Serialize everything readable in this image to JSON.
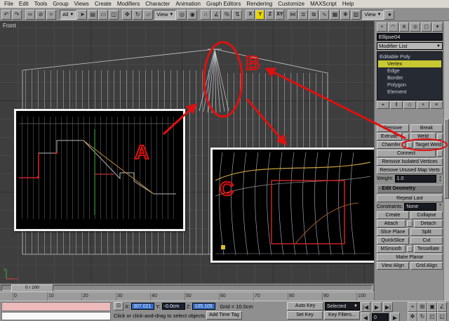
{
  "menu": {
    "items": [
      "File",
      "Edit",
      "Tools",
      "Group",
      "Views",
      "Create",
      "Modifiers",
      "Character",
      "Animation",
      "Graph Editors",
      "Rendering",
      "Customize",
      "MAXScript",
      "Help"
    ]
  },
  "toolbar": {
    "icons": {
      "undo": "↶",
      "redo": "↷",
      "link": "∞",
      "unlink": "⊘",
      "bind": "≈",
      "select": "➤",
      "by_name": "▤",
      "region": "▭",
      "crossing": "◫",
      "move": "✥",
      "rotate": "↻",
      "scale": "▱",
      "pivot": "◎",
      "manip": "◉",
      "snap": "∩",
      "angle": "∡",
      "percent": "%",
      "spinner": "⇅",
      "mirror": "⋈",
      "align": "≣",
      "layer": "⧉",
      "curve": "∿",
      "schem": "▦",
      "material": "❖",
      "render": "▥",
      "teapot": "●"
    },
    "selection_filter": "All",
    "ref_coord": "View",
    "render_type": "View",
    "axis": {
      "x": "X",
      "y": "Y",
      "z": "Z",
      "xy": "XY"
    }
  },
  "viewport": {
    "label": "Front"
  },
  "annotations": {
    "a": "A",
    "b": "B",
    "c": "C"
  },
  "command_panel": {
    "tabs": {
      "create": "+",
      "modify": "◠",
      "hierarchy": "⋔",
      "motion": "◎",
      "display": "▢",
      "utilities": "✦"
    },
    "object_name": "Ellipse04",
    "modifier_list": "Modifier List",
    "stack_root": "Editable Poly",
    "stack_items": [
      {
        "label": "Vertex",
        "selected": true
      },
      {
        "label": "Edge"
      },
      {
        "label": "Border"
      },
      {
        "label": "Polygon"
      },
      {
        "label": "Element"
      }
    ],
    "stack_ops": {
      "pin": "⌖",
      "show_end": "‖",
      "unique": "◇",
      "remove": "×",
      "configure": "≡"
    },
    "edit_vertices": {
      "remove": "Remove",
      "break": "Break",
      "extrude": "Extrude",
      "weld": "Weld",
      "chamfer": "Chamfer",
      "target_weld": "Target Weld",
      "connect": "Connect",
      "remove_isolated": "Remove Isolated Vertices",
      "remove_unused": "Remove Unused Map Verts",
      "weight_label": "Weight:",
      "weight_value": "1.0"
    },
    "edit_geometry": {
      "header": "- Edit Geometry",
      "repeat_last": "Repeat Last",
      "constraints_label": "Constraints:",
      "constraints_value": "None",
      "create": "Create",
      "collapse": "Collapse",
      "attach": "Attach",
      "detach": "Detach",
      "slice_plane": "Slice Plane",
      "split": "Split",
      "quickslice": "QuickSlice",
      "cut": "Cut",
      "msmooth": "MSmooth",
      "tessellate": "Tessellate",
      "make_planar": "Make Planar",
      "view_align": "View Align",
      "grid_align": "Grid Align"
    }
  },
  "timeline": {
    "slider_label": "0 / 100",
    "ticks": [
      "0",
      "10",
      "20",
      "30",
      "40",
      "50",
      "60",
      "70",
      "80",
      "90",
      "100"
    ]
  },
  "status": {
    "lock_glyph": "⊡",
    "x_label": "X:",
    "x_value": "307.021",
    "y_label": "Y:",
    "y_value": "-0.0cm",
    "z_label": "Z:",
    "z_value": "105.105",
    "grid": "Grid = 10.0cm",
    "prompt": "Click or click-and-drag to select objects",
    "add_time_tag": "Add Time Tag",
    "auto_key": "Auto Key",
    "selected_mode": "Selected",
    "set_key": "Set Key",
    "key_filters": "Key Filters...",
    "time_value": "0"
  },
  "transport": {
    "start": "|◀",
    "play": "▶",
    "end": "▶|",
    "prev": "◀",
    "next": "▶"
  },
  "nav": {
    "zoom": "⌖",
    "zoom_all": "⊞",
    "zoom_ext": "▣",
    "fov": "∠",
    "pan": "✥",
    "arc": "↻",
    "region": "◰",
    "maxmin": "◱"
  },
  "colors": {
    "annotation": "#e01010",
    "axis_active": "#e8d400",
    "viewport_bg": "#3e3e3e"
  }
}
